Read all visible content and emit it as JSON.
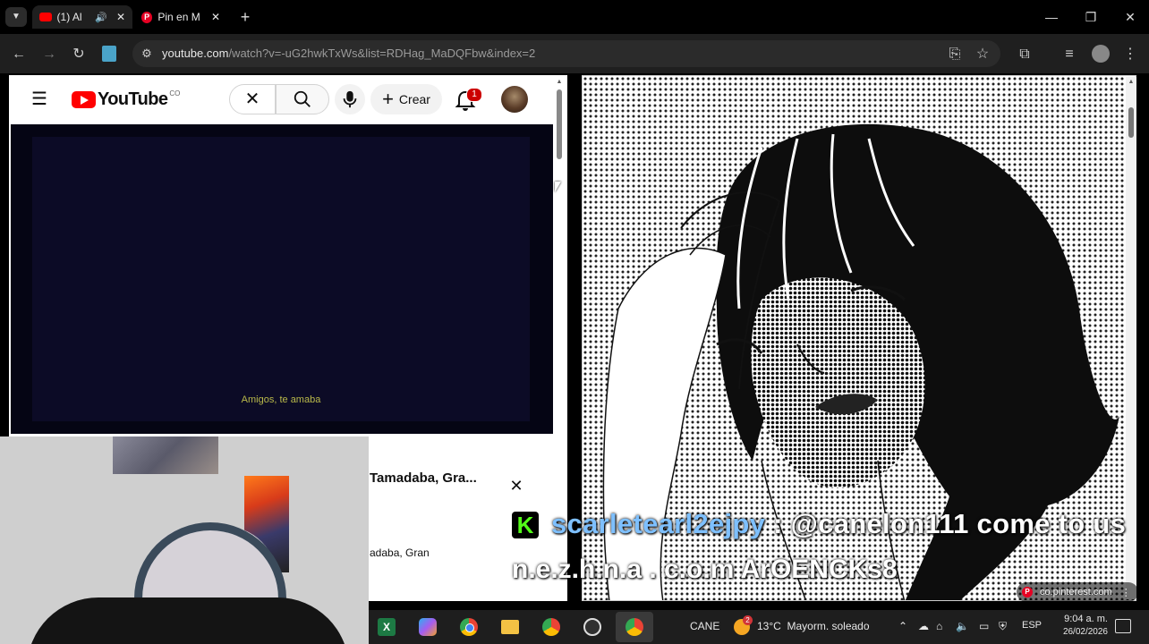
{
  "browser": {
    "tabs": [
      {
        "title": "(1) Al",
        "active": true
      },
      {
        "title": "Pin en M",
        "active": false
      }
    ],
    "url_main": "youtube.com",
    "url_rest": "/watch?v=-uG2hwkTxWs&list=RDHag_MaDQFbw&index=2"
  },
  "youtube": {
    "logo_text": "YouTube",
    "country_code": "CO",
    "create_label": "Crear",
    "notification_count": "1",
    "subtitle": "Amigos, te amaba",
    "popup_title": "Tamadaba, Gra...",
    "popup_subtitle": "adaba, Gran"
  },
  "pinterest": {
    "source_label": "co.pinterest.com"
  },
  "chat": {
    "username": "scarletearl2ejpy",
    "message": " : @canelon111 come to us",
    "line2": "n.e.z.h.n.a . c.o.m ArOENCKs8",
    "badge_letter": "K"
  },
  "taskbar": {
    "cane_label": "CANE",
    "weather_badge": "2",
    "weather": "13°C  Mayorm. soleado",
    "lang": "ESP",
    "time": "9:04 a. m.",
    "date": "26/02/2026"
  },
  "colors": {
    "youtube_red": "#ff0000",
    "chat_username": "#7ec0ff",
    "kick_green": "#53fc18",
    "pinterest_red": "#e60023"
  }
}
